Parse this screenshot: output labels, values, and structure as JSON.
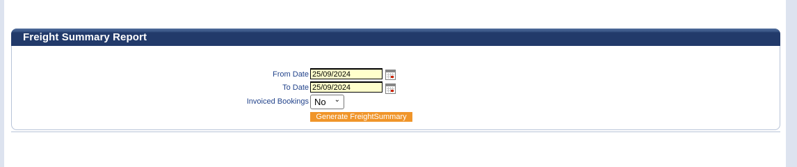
{
  "report": {
    "title": "Freight Summary Report"
  },
  "form": {
    "from_date_label": "From Date",
    "from_date_value": "25/09/2024",
    "to_date_label": "To Date",
    "to_date_value": "25/09/2024",
    "invoiced_label": "Invoiced Bookings",
    "invoiced_value": "No",
    "generate_label": "Generate FreightSummary"
  },
  "icons": {
    "calendar": "calendar-icon",
    "dropdown": "chevron-down-icon"
  },
  "colors": {
    "header_bg": "#223a6a",
    "label_text": "#22438b",
    "input_bg": "#ffffcc",
    "button_bg": "#f0952a"
  }
}
